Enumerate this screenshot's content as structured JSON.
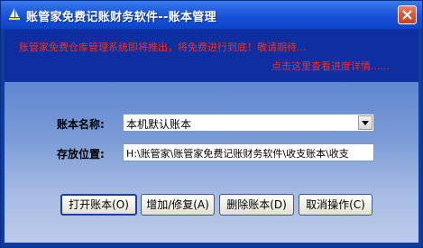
{
  "window": {
    "title": "账管家免费记账财务软件--账本管理",
    "icons": {
      "app": "sailboat-icon",
      "close": "close-icon"
    },
    "colors": {
      "titlebar": "#1550d6",
      "banner_bg": "#0f2fa0",
      "banner_text": "#ff2a1a"
    }
  },
  "banner": {
    "line1": "账管家免费仓库管理系统即将推出，将免费进行到底！敬请期待...",
    "line2": "点击这里查看进度详情......"
  },
  "form": {
    "ledger_label": "账本名称:",
    "ledger_value": "本机默认账本",
    "path_label": "存放位置:",
    "path_value": "H:\\账管家\\账管家免费记账财务软件\\收支账本\\收支"
  },
  "buttons": {
    "open": "打开账本(O)",
    "add_edit": "增加/修复(A)",
    "delete": "删除账本(D)",
    "cancel": "取消操作(C)"
  }
}
